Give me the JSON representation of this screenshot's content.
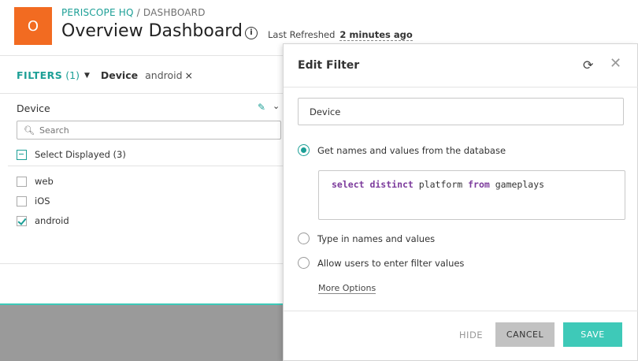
{
  "header": {
    "logo_letter": "O",
    "org": "PERISCOPE HQ",
    "separator": " / ",
    "section": "DASHBOARD",
    "title": "Overview Dashboard",
    "refresh_label": "Last Refreshed",
    "refresh_ago": "2 minutes ago"
  },
  "filter_bar": {
    "label": "FILTERS",
    "count": "(1)",
    "device_label": "Device",
    "device_value": "android",
    "remove_glyph": "×"
  },
  "filter_panel": {
    "title": "Device",
    "search_placeholder": "Search",
    "select_all_label": "Select Displayed (3)",
    "options": [
      {
        "label": "web",
        "checked": false
      },
      {
        "label": "iOS",
        "checked": false
      },
      {
        "label": "android",
        "checked": true
      }
    ]
  },
  "modal": {
    "title": "Edit Filter",
    "name_value": "Device",
    "radio_database": "Get names and values from the database",
    "sql_keyword_1": "select distinct",
    "sql_text_1": " platform ",
    "sql_keyword_2": "from",
    "sql_text_2": " gameplays",
    "radio_type": "Type in names and values",
    "radio_allow": "Allow users to enter filter values",
    "more_options": "More Options",
    "hide_label": "HIDE",
    "cancel_label": "CANCEL",
    "save_label": "SAVE",
    "selected_source": "database"
  },
  "colors": {
    "brand_orange": "#f26b21",
    "accent_teal": "#1c9f96",
    "save_teal": "#3ec9b8",
    "sql_keyword": "#7c3b9c"
  }
}
